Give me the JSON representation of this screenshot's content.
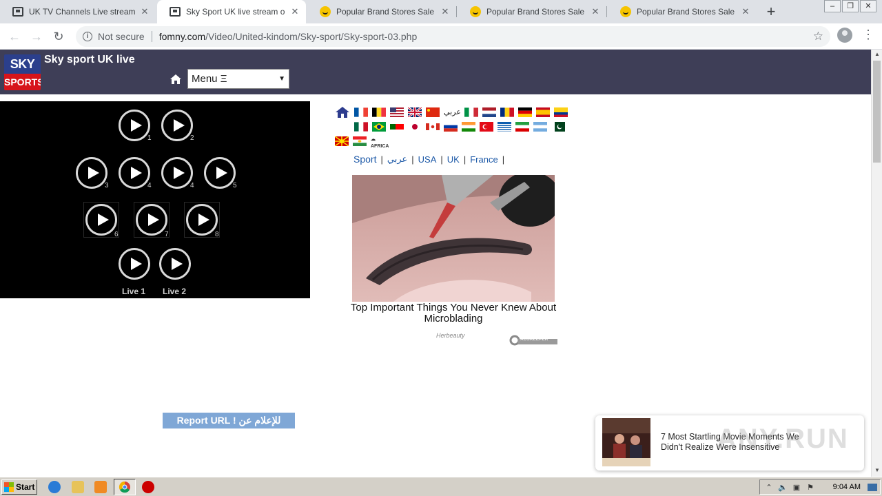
{
  "browser": {
    "tabs": [
      {
        "title": "UK TV Channels Live stream online",
        "icon": "tv-icon",
        "active": false
      },
      {
        "title": "Sky Sport UK live stream online free",
        "icon": "tv-icon",
        "active": true
      },
      {
        "title": "Popular Brand Stores Sale Promo",
        "icon": "smile-icon",
        "active": false
      },
      {
        "title": "Popular Brand Stores Sale Promo",
        "icon": "smile-icon",
        "active": false
      },
      {
        "title": "Popular Brand Stores Sale Promo",
        "icon": "smile-icon",
        "active": false
      }
    ],
    "new_tab": "+",
    "security_label": "Not secure",
    "url_host": "fomny.com",
    "url_path": "/Video/United-kindom/Sky-sport/Sky-sport-03.php"
  },
  "site": {
    "logo_top": "SKY",
    "logo_bottom": "SPORTS",
    "title": "Sky sport UK live",
    "menu_label": "Menu Ξ"
  },
  "player": {
    "channels": [
      {
        "label": "1"
      },
      {
        "label": "2"
      },
      {
        "label": "3"
      },
      {
        "label": "4"
      },
      {
        "label": "4"
      },
      {
        "label": "5"
      },
      {
        "label": "6"
      },
      {
        "label": "7"
      },
      {
        "label": "8"
      }
    ],
    "live": [
      {
        "label": "Live 1"
      },
      {
        "label": "Live 2"
      }
    ]
  },
  "flags": {
    "arabic": "عربي",
    "africa": "AFRICA"
  },
  "lang_links": [
    {
      "label": "Sport"
    },
    {
      "label": "عربي"
    },
    {
      "label": "USA"
    },
    {
      "label": "UK"
    },
    {
      "label": "France"
    }
  ],
  "ad": {
    "title": "Top Important Things You Never Knew About Microblading",
    "source": "Herbeauty",
    "network": "ADSKEEPER"
  },
  "report_button": "Report URL ! للإعلام عن مشكل",
  "promo": {
    "text": "7 Most Startling Movie Moments We Didn't Realize Were Insensitive"
  },
  "watermark": "ANY.RUN",
  "taskbar": {
    "start_label": "Start",
    "clock": "9:04 AM"
  }
}
